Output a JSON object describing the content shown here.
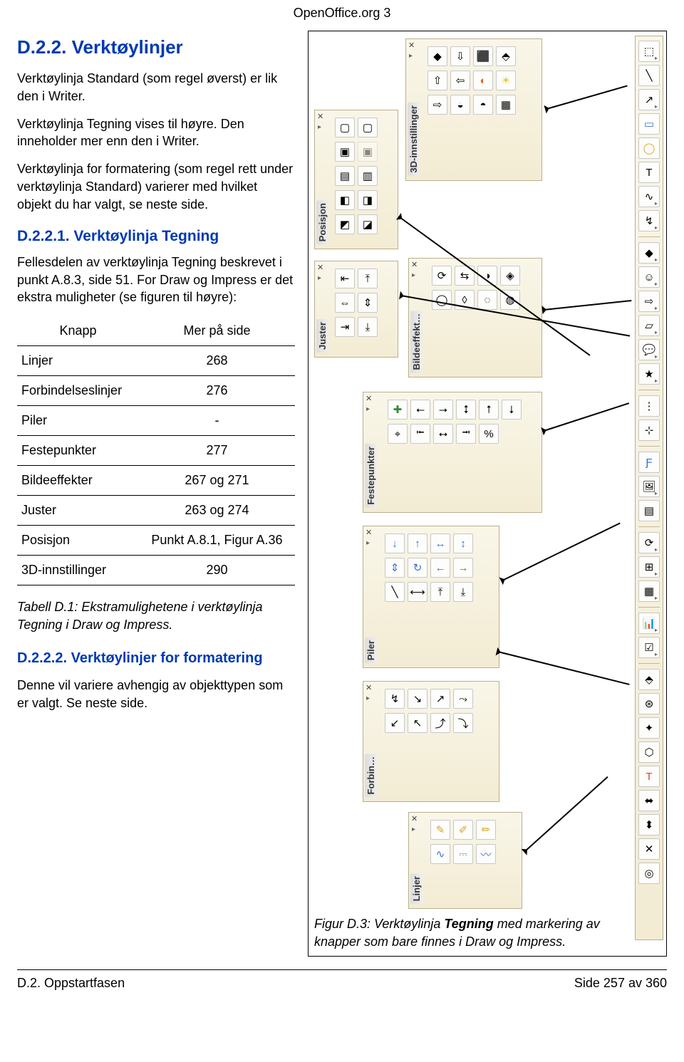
{
  "header": {
    "title": "OpenOffice.org 3"
  },
  "section_h2": "D.2.2. Verktøylinjer",
  "p1": "Verktøylinja Standard (som regel øverst) er lik den i Writer.",
  "p2": "Verktøylinja Tegning vises til høyre. Den inneholder mer enn den i Writer.",
  "p3": "Verktøylinja for formatering (som regel rett under verktøylinja Standard) varierer med hvilket objekt du har valgt, se neste side.",
  "section_h3": "D.2.2.1. Verktøylinja Tegning",
  "p4": "Fellesdelen av verktøylinja Tegning beskrevet i punkt A.8.3, side 51. For Draw og Impress er det ekstra muligheter  (se figuren til høyre):",
  "table": {
    "head": {
      "c1": "Knapp",
      "c2": "Mer på side"
    },
    "rows": [
      {
        "c1": "Linjer",
        "c2": "268"
      },
      {
        "c1": "Forbindelseslinjer",
        "c2": "276"
      },
      {
        "c1": "Piler",
        "c2": "-"
      },
      {
        "c1": "Festepunkter",
        "c2": "277"
      },
      {
        "c1": "Bildeeffekter",
        "c2": "267 og 271"
      },
      {
        "c1": "Juster",
        "c2": "263 og 274"
      },
      {
        "c1": "Posisjon",
        "c2": "Punkt A.8.1, Figur A.36"
      },
      {
        "c1": "3D-innstillinger",
        "c2": "290"
      }
    ]
  },
  "table_caption": "Tabell D.1: Ekstramulighetene i verktøylinja Tegning i Draw og Impress.",
  "section_h4": "D.2.2.2. Verktøylinjer for formatering",
  "p5": "Denne vil variere avhengig av objekttypen som er valgt. Se neste side.",
  "figure": {
    "caption_prefix": "Figur D.3: Verktøylinja ",
    "caption_bold": "Tegning",
    "caption_suffix": " med markering av knapper som bare finnes i Draw og Impress."
  },
  "panels": {
    "posisjon": "Posisjon",
    "innstillinger3d": "3D-innstillinger",
    "juster": "Juster",
    "bildeeffekt": "Bildeeffekt…",
    "festepunkter": "Festepunkter",
    "piler": "Piler",
    "forbin": "Forbin…",
    "linjer": "Linjer"
  },
  "footer": {
    "left": "D.2. Oppstartfasen",
    "right": "Side 257 av 360"
  }
}
